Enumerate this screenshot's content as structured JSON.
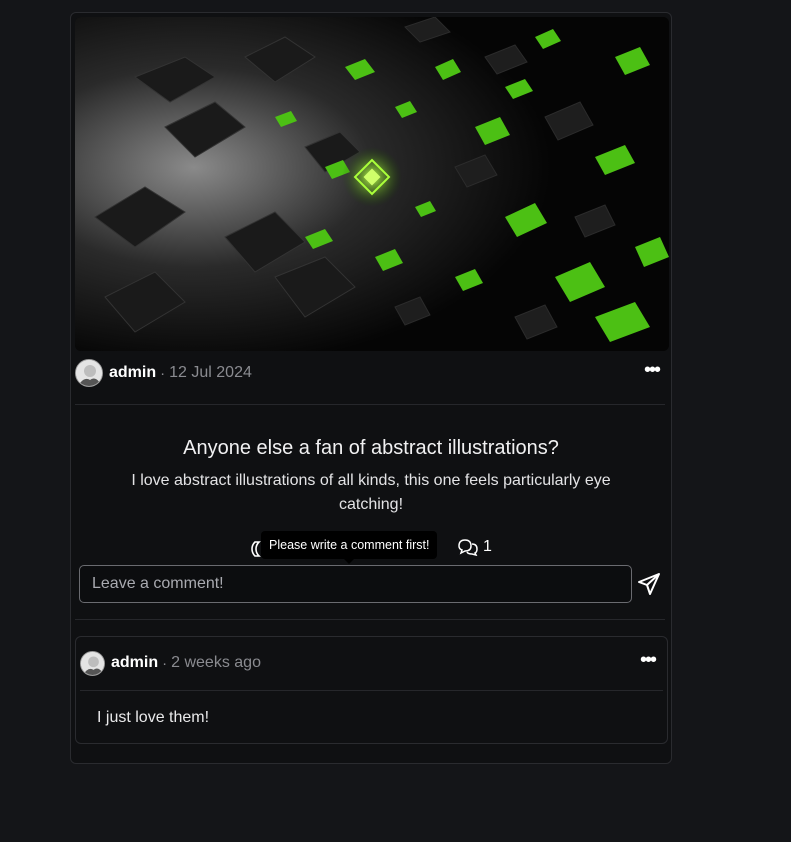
{
  "post": {
    "author": "admin",
    "separator": "·",
    "date": "12 Jul 2024",
    "title": "Anyone else a fan of abstract illustrations?",
    "body": "I love abstract illustrations of all kinds, this one feels particularly eye catching!",
    "tooltip": "Please write a comment first!",
    "comment_count": "1",
    "more_icon": "more-icon",
    "accent_color": "#7cfc1d"
  },
  "comment_form": {
    "placeholder": "Leave a comment!",
    "send_icon": "send-icon"
  },
  "comments": [
    {
      "author": "admin",
      "separator": "·",
      "date": "2 weeks ago",
      "text": "I just love them!"
    }
  ]
}
